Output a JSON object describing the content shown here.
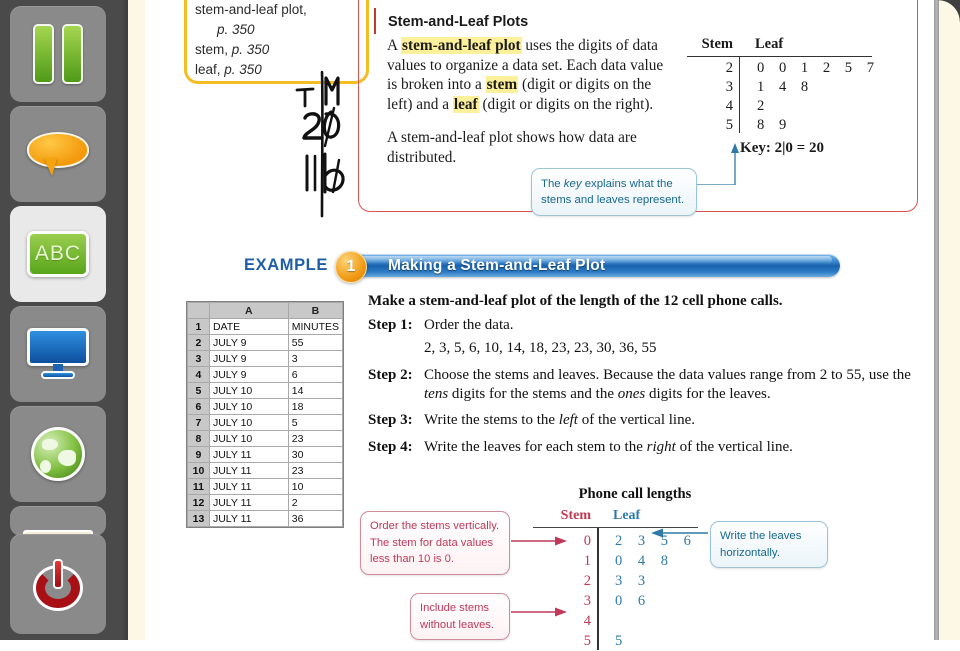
{
  "sidebar": {
    "items": [
      {
        "name": "pause-button",
        "icon": "pause-icon",
        "active": false
      },
      {
        "name": "annotate-button",
        "icon": "speech-bubble-icon",
        "active": false
      },
      {
        "name": "abc-button",
        "icon": "abc-board-icon",
        "active": true
      },
      {
        "name": "screen-button",
        "icon": "monitor-icon",
        "active": false
      },
      {
        "name": "web-button",
        "icon": "globe-icon",
        "active": false
      },
      {
        "name": "partial-button",
        "icon": "partial-icon",
        "active": false
      },
      {
        "name": "power-button",
        "icon": "power-icon",
        "active": false
      }
    ]
  },
  "vocabulary": {
    "lines": [
      "stem-and-leaf plot,",
      "p. 350",
      "stem, p. 350",
      "leaf, p. 350"
    ],
    "entries": [
      {
        "term": "stem-and-leaf plot,",
        "page": "p. 350"
      },
      {
        "term": "stem,",
        "page": "p. 350"
      },
      {
        "term": "leaf,",
        "page": "p. 350"
      }
    ]
  },
  "handwriting": {
    "marks": [
      "T",
      "M",
      "20",
      "1 b"
    ]
  },
  "key_idea": {
    "title": "Stem-and-Leaf Plots",
    "paragraph1_pre": "A ",
    "paragraph1_hl1": "stem-and-leaf plot",
    "paragraph1_mid1": " uses the digits of data values to organize a data set. Each data value is broken into a ",
    "paragraph1_hl2": "stem",
    "paragraph1_mid2": " (digit or digits on the left) and a ",
    "paragraph1_hl3": "leaf",
    "paragraph1_end": " (digit or digits on the right).",
    "paragraph2": "A stem-and-leaf plot shows how data are distributed.",
    "table": {
      "stem_header": "Stem",
      "leaf_header": "Leaf",
      "rows": [
        {
          "stem": "2",
          "leaves": "0 0 1 2 5 7"
        },
        {
          "stem": "3",
          "leaves": "1 4 8"
        },
        {
          "stem": "4",
          "leaves": "2"
        },
        {
          "stem": "5",
          "leaves": "8 9"
        }
      ],
      "key": "Key:  2|0 = 20"
    },
    "callout_pre": "The ",
    "callout_em": "key",
    "callout_post": " explains what the stems and leaves represent."
  },
  "example": {
    "label": "EXAMPLE",
    "number": "1",
    "title": "Making a Stem-and-Leaf Plot",
    "prompt": "Make a stem-and-leaf plot of the length of the 12 cell phone calls."
  },
  "spreadsheet": {
    "columns": [
      "A",
      "B"
    ],
    "rows": [
      {
        "n": "1",
        "a": "DATE",
        "b": "MINUTES"
      },
      {
        "n": "2",
        "a": "JULY 9",
        "b": "55"
      },
      {
        "n": "3",
        "a": "JULY 9",
        "b": "3"
      },
      {
        "n": "4",
        "a": "JULY 9",
        "b": "6"
      },
      {
        "n": "5",
        "a": "JULY 10",
        "b": "14"
      },
      {
        "n": "6",
        "a": "JULY 10",
        "b": "18"
      },
      {
        "n": "7",
        "a": "JULY 10",
        "b": "5"
      },
      {
        "n": "8",
        "a": "JULY 10",
        "b": "23"
      },
      {
        "n": "9",
        "a": "JULY 11",
        "b": "30"
      },
      {
        "n": "10",
        "a": "JULY 11",
        "b": "23"
      },
      {
        "n": "11",
        "a": "JULY 11",
        "b": "10"
      },
      {
        "n": "12",
        "a": "JULY 11",
        "b": "2"
      },
      {
        "n": "13",
        "a": "JULY 11",
        "b": "36"
      }
    ]
  },
  "steps": {
    "step1_label": "Step 1:",
    "step1_text": "Order the data.",
    "step1_data": "2, 3, 5, 6, 10, 14, 18, 23, 23, 30, 36, 55",
    "step2_label": "Step 2:",
    "step2_a": "Choose the stems and leaves. Because the data values range from 2 to 55, use the ",
    "step2_em1": "tens",
    "step2_b": " digits for the stems and the ",
    "step2_em2": "ones",
    "step2_c": " digits for the leaves.",
    "step3_label": "Step 3:",
    "step3_a": "Write the stems to the ",
    "step3_em": "left",
    "step3_b": " of the vertical line.",
    "step4_label": "Step 4:",
    "step4_a": "Write the leaves for each stem to the ",
    "step4_em": "right",
    "step4_b": " of the vertical line."
  },
  "plot": {
    "title": "Phone call lengths",
    "stem_header": "Stem",
    "leaf_header": "Leaf",
    "rows": [
      {
        "stem": "0",
        "leaves": "2 3 5 6"
      },
      {
        "stem": "1",
        "leaves": "0 4 8"
      },
      {
        "stem": "2",
        "leaves": "3 3"
      },
      {
        "stem": "3",
        "leaves": "0 6"
      },
      {
        "stem": "4",
        "leaves": ""
      },
      {
        "stem": "5",
        "leaves": "5"
      }
    ],
    "callout_order": "Order the stems vertically. The stem for data values less than 10 is 0.",
    "callout_include": "Include stems without leaves.",
    "callout_write": "Write the leaves horizontally."
  },
  "colors": {
    "example_blue": "#1a62ad",
    "key_red": "#d9534f",
    "vocab_yellow": "#f3bd24",
    "stem_red": "#c03a52",
    "leaf_blue": "#2f79a8",
    "page_cream": "#fdf8e6"
  },
  "chart_data": {
    "type": "table",
    "title": "Phone call lengths",
    "xlabel": "Stem",
    "ylabel": "Leaf",
    "categories": [
      "0",
      "1",
      "2",
      "3",
      "4",
      "5"
    ],
    "series": [
      {
        "name": "Leaf",
        "values": [
          [
            2,
            3,
            5,
            6
          ],
          [
            0,
            4,
            8
          ],
          [
            3,
            3
          ],
          [
            0,
            6
          ],
          [],
          [
            5
          ]
        ]
      }
    ],
    "raw_data": [
      2,
      3,
      5,
      6,
      10,
      14,
      18,
      23,
      23,
      30,
      36,
      55
    ],
    "legend": "none",
    "grid": false
  }
}
